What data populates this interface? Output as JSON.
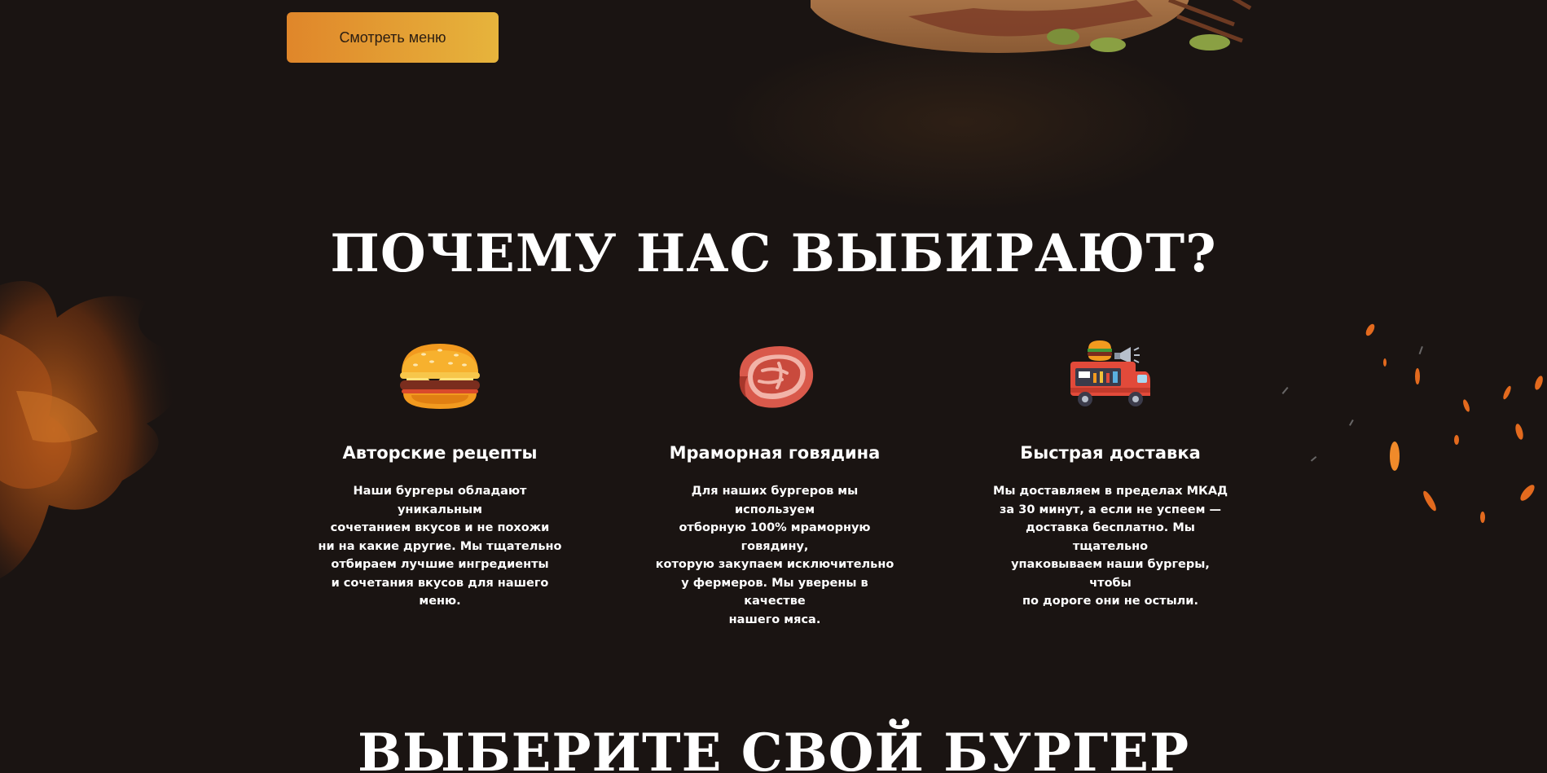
{
  "hero": {
    "menu_button_label": "Смотреть меню"
  },
  "why_section": {
    "title": "ПОЧЕМУ НАС ВЫБИРАЮТ?",
    "features": [
      {
        "icon": "burger-icon",
        "title": "Авторские рецепты",
        "text": "Наши бургеры обладают уникальным\nсочетанием вкусов и не похожи\nни на какие другие. Мы тщательно\nотбираем лучшие ингредиенты\nи сочетания вкусов для нашего меню."
      },
      {
        "icon": "meat-steak-icon",
        "title": "Мраморная говядина",
        "text": "Для наших бургеров мы используем\nотборную 100% мраморную говядину,\nкоторую закупаем исключительно\nу фермеров. Мы уверены в качестве\nнашего мяса."
      },
      {
        "icon": "food-truck-icon",
        "title": "Быстрая доставка",
        "text": "Мы доставляем в пределах МКАД\nза 30 минут, а если не успеем —\nдоставка бесплатно. Мы тщательно\nупаковываем наши бургеры, чтобы\nпо дороге они не остыли."
      }
    ]
  },
  "choose_section": {
    "title": "ВЫБЕРИТЕ СВОЙ БУРГЕР"
  },
  "colors": {
    "background": "#1a1412",
    "button_gradient_start": "#e0862a",
    "button_gradient_end": "#e6b43c",
    "text": "#ffffff"
  }
}
